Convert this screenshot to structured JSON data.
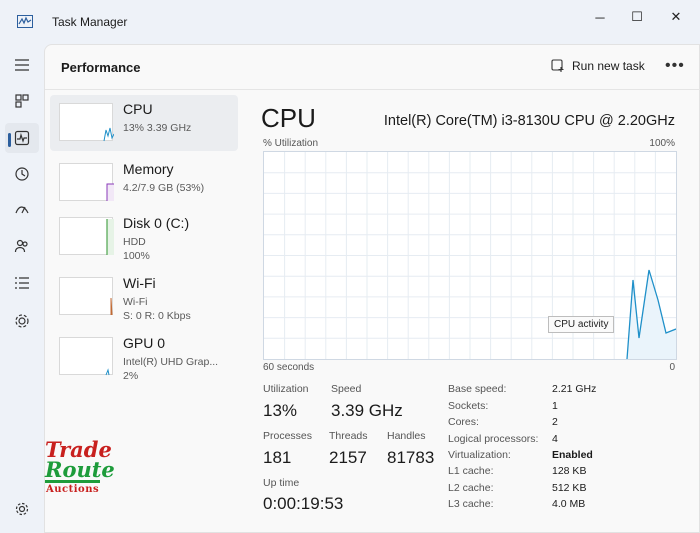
{
  "window": {
    "title": "Task Manager",
    "minimize_glyph": "─",
    "maximize_glyph": "☐",
    "close_glyph": "✕"
  },
  "nav": {
    "items": [
      {
        "icon": "hamburger-menu-icon"
      },
      {
        "icon": "processes-icon"
      },
      {
        "icon": "performance-icon",
        "active": true
      },
      {
        "icon": "app-history-icon"
      },
      {
        "icon": "startup-apps-icon"
      },
      {
        "icon": "users-icon"
      },
      {
        "icon": "details-icon"
      },
      {
        "icon": "services-icon"
      },
      {
        "icon": "settings-icon"
      }
    ]
  },
  "header": {
    "title": "Performance",
    "run_task_label": "Run new task",
    "more_label": "•••"
  },
  "perf_items": [
    {
      "name": "CPU",
      "sub": [
        "13% 3.39 GHz"
      ],
      "color": "#1f90c9",
      "selected": true
    },
    {
      "name": "Memory",
      "sub": [
        "4.2/7.9 GB (53%)"
      ],
      "color": "#8a3ab9"
    },
    {
      "name": "Disk 0 (C:)",
      "sub": [
        "HDD",
        "100%"
      ],
      "color": "#4ca44c"
    },
    {
      "name": "Wi-Fi",
      "sub": [
        "Wi-Fi",
        "S: 0 R: 0 Kbps"
      ],
      "color": "#c16a34"
    },
    {
      "name": "GPU 0",
      "sub": [
        "Intel(R) UHD Grap...",
        "2%"
      ],
      "color": "#1f90c9"
    }
  ],
  "cpu": {
    "title": "CPU",
    "model": "Intel(R) Core(TM) i3-8130U CPU @ 2.20GHz",
    "util_label": "% Utilization",
    "util_max": "100%",
    "axis_left": "60 seconds",
    "axis_right": "0",
    "tooltip": "CPU activity",
    "graph_color": "#1f90c9"
  },
  "stats": {
    "utilization_label": "Utilization",
    "utilization_value": "13%",
    "speed_label": "Speed",
    "speed_value": "3.39 GHz",
    "processes_label": "Processes",
    "processes_value": "181",
    "threads_label": "Threads",
    "threads_value": "2157",
    "handles_label": "Handles",
    "handles_value": "81783",
    "uptime_label": "Up time",
    "uptime_value": "0:00:19:53"
  },
  "specs": [
    {
      "label": "Base speed:",
      "value": "2.21 GHz"
    },
    {
      "label": "Sockets:",
      "value": "1"
    },
    {
      "label": "Cores:",
      "value": "2"
    },
    {
      "label": "Logical processors:",
      "value": "4"
    },
    {
      "label": "Virtualization:",
      "value": "Enabled",
      "bold": true
    },
    {
      "label": "L1 cache:",
      "value": "128 KB"
    },
    {
      "label": "L2 cache:",
      "value": "512 KB"
    },
    {
      "label": "L3 cache:",
      "value": "4.0 MB"
    }
  ],
  "watermark": {
    "line1": "Trade",
    "line2": "Route",
    "line3": "Auctions"
  }
}
